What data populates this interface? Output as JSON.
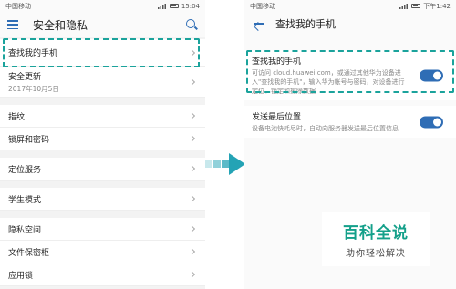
{
  "left": {
    "status": {
      "carrier": "中国移动",
      "time": "15:04"
    },
    "title": "安全和隐私",
    "rows": [
      {
        "label": "查找我的手机"
      },
      {
        "label": "安全更新",
        "sub": "2017年10月5日"
      },
      {
        "label": "指纹"
      },
      {
        "label": "锁屏和密码"
      },
      {
        "label": "定位服务"
      },
      {
        "label": "学生模式"
      },
      {
        "label": "隐私空间"
      },
      {
        "label": "文件保密柜"
      },
      {
        "label": "应用锁"
      }
    ]
  },
  "right": {
    "status": {
      "carrier": "中国移动",
      "time": "下午1:42"
    },
    "title": "查找我的手机",
    "settings": [
      {
        "title": "查找我的手机",
        "desc": "可访问 cloud.huawei.com，或通过其他华为设备进入\"查找我的手机\"，输入华为帐号与密码，对设备进行定位、锁定和擦除数据",
        "enabled": true
      },
      {
        "title": "发送最后位置",
        "desc": "设备电池快耗尽时，自动向服务器发送最后位置信息",
        "enabled": true
      }
    ]
  },
  "watermark": {
    "title": "百科全说",
    "subtitle": "助你轻松解决"
  },
  "colors": {
    "accent": "#2f6db5",
    "highlight": "#1ba39c",
    "arrow": "#24a3b5"
  }
}
